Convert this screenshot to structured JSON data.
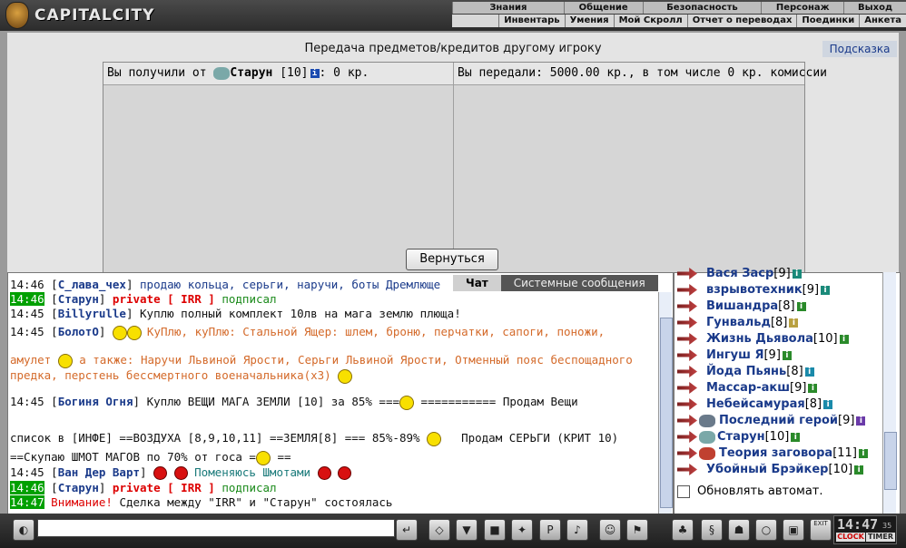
{
  "brand": {
    "logo_text": "CAPITALCITY"
  },
  "menu_top": [
    "Знания",
    "Общение",
    "Безопасность",
    "Персонаж",
    "Выход"
  ],
  "menu_sub": [
    "Инвентарь",
    "Умения",
    "Мой Скролл",
    "Отчет о переводах",
    "Поединки",
    "Анкета"
  ],
  "transfer": {
    "title": "Передача предметов/кредитов другому игроку",
    "hint_button": "Подсказка",
    "received_prefix": "Вы получили от",
    "received_name": "Старун",
    "received_level": "[10]",
    "received_amount": ": 0 кр.",
    "sent_text": "Вы передали: 5000.00 кр., в том числе 0 кр. комиссии",
    "back_button": "Вернуться"
  },
  "chat_tabs": {
    "active": "Чат",
    "inactive": "Системные сообщения"
  },
  "chat": {
    "l1": {
      "time": "14:46",
      "name": "С_лава_чех",
      "text": "продаю кольца, серьги, наручи, боты Дремлюще"
    },
    "l2": {
      "time": "14:46",
      "name": "Старун",
      "priv": "private [ IRR ]",
      "text": "подписал"
    },
    "l3": {
      "time": "14:45",
      "name": "Billyrulle",
      "text": "Куплю полный комплект 10лв на мага землю плюща!"
    },
    "l4": {
      "time": "14:45",
      "name": "БолотО",
      "text": "КуПлю, куПлю: Стальной Ящер: шлем, броню, перчатки, сапоги, поножи,"
    },
    "l5": {
      "a": "амулет",
      "b": "а также: Наручи Львиной Ярости, Серьги Львиной Ярости, Отменный пояс беспощадного"
    },
    "l6": {
      "text": "предка, перстень бессмертного военачальника(x3)"
    },
    "l7": {
      "time": "14:45",
      "name": "Богиня Огня",
      "a": "Куплю ВЕЩИ МАГА ЗЕМЛИ [10] за 85% ===",
      "b": "=========== Продам Вещи"
    },
    "l8": {
      "a": "список в [ИНФЕ] ==ВОЗДУХА [8,9,10,11] ==ЗЕМЛЯ[8] === 85%-89%",
      "b": "Продам СЕРЬГИ (КРИТ 10)"
    },
    "l9": {
      "a": "==Скупаю ШМОТ МАГОВ по 70% от госа =",
      "b": "=="
    },
    "l10": {
      "time": "14:45",
      "name": "Ван Дер Варт",
      "text": "Поменяюсь Шмотами"
    },
    "l11": {
      "time": "14:46",
      "name": "Старун",
      "priv": "private [ IRR ]",
      "text": "подписал"
    },
    "l12": {
      "time": "14:47",
      "warn": "Внимание!",
      "text": "Сделка между \"IRR\" и \"Старун\" состоялась"
    }
  },
  "players": [
    {
      "name": "Вася Заср",
      "level": "[9]"
    },
    {
      "name": "взрывотехник",
      "level": "[9]"
    },
    {
      "name": "Вишандра",
      "level": "[8]"
    },
    {
      "name": "Гунвальд",
      "level": "[8]"
    },
    {
      "name": "Жизнь Дьявола",
      "level": "[10]"
    },
    {
      "name": "Ингуш Я",
      "level": "[9]"
    },
    {
      "name": "Йода Пьянь",
      "level": "[8]"
    },
    {
      "name": "Массар-акш",
      "level": "[9]"
    },
    {
      "name": "Небейсамурая",
      "level": "[8]"
    },
    {
      "name": "Последний герой",
      "level": "[9]"
    },
    {
      "name": "Старун",
      "level": "[10]"
    },
    {
      "name": "Теория заговора",
      "level": "[11]"
    },
    {
      "name": "Убойный Брэйкер",
      "level": "[10]"
    }
  ],
  "auto_refresh_label": "Обновлять автомат.",
  "clock": {
    "time": "14:47",
    "seconds": "35",
    "clock_label": "CLOCK",
    "timer_label": "TIMER",
    "exit_label": "EXIT"
  },
  "colors": {
    "accent": "#1a3a8a",
    "timestamp_bg": "#00a000",
    "private": "#dd0000"
  }
}
